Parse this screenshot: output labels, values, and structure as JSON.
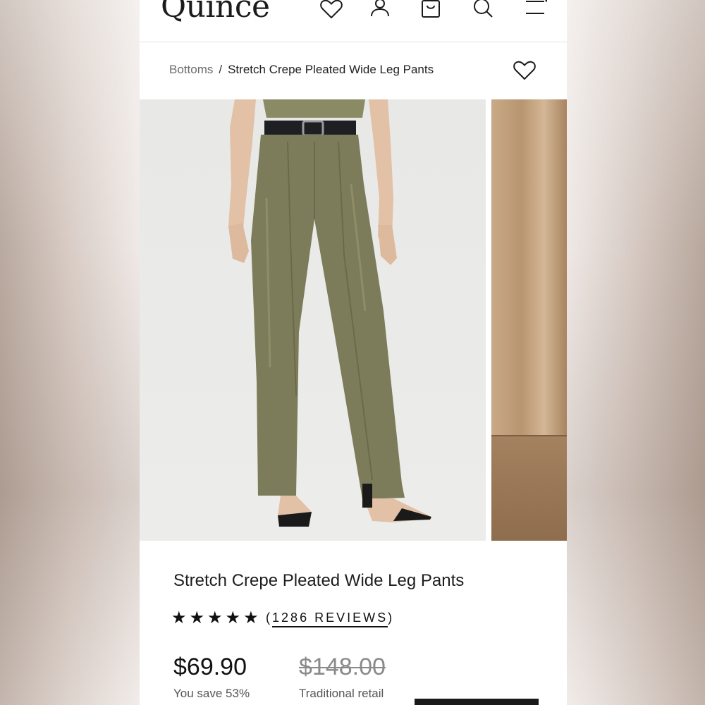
{
  "header": {
    "logo": "Quince",
    "icons": [
      "heart-icon",
      "account-icon",
      "bag-icon",
      "search-icon",
      "menu-icon"
    ]
  },
  "breadcrumb": {
    "parent": "Bottoms",
    "separator": "/",
    "current": "Stretch Crepe Pleated Wide Leg Pants"
  },
  "product": {
    "title": "Stretch Crepe Pleated Wide Leg Pants",
    "stars": "★★★★★",
    "rating_value": 5,
    "reviews_open": "(",
    "reviews_label": "1286 REVIEWS",
    "reviews_close": ")",
    "price": "$69.90",
    "savings": "You save 53%",
    "original_price": "$148.00",
    "original_label": "Traditional retail"
  },
  "colors": {
    "pants_olive": "#7d7c5a",
    "text_dark": "#1d1d1d",
    "muted": "#6b6b6b"
  }
}
